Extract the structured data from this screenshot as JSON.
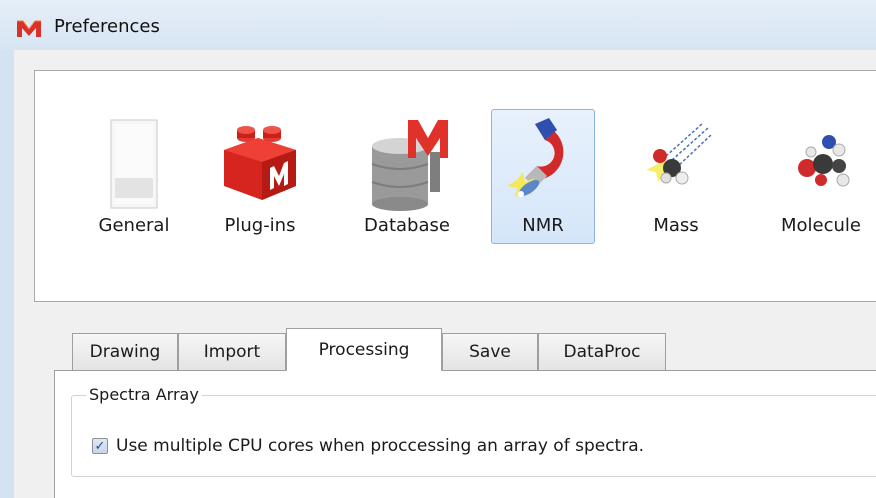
{
  "window": {
    "title": "Preferences",
    "icon": "mestrenova-m-icon"
  },
  "categories": [
    {
      "label": "General",
      "icon": "document-page-icon",
      "selected": false
    },
    {
      "label": "Plug-ins",
      "icon": "red-lego-brick-icon",
      "selected": false
    },
    {
      "label": "Database",
      "icon": "database-cylinder-icon",
      "selected": false
    },
    {
      "label": "NMR",
      "icon": "magnet-icon",
      "selected": true
    },
    {
      "label": "Mass",
      "icon": "molecule-beam-icon",
      "selected": false
    },
    {
      "label": "Molecule",
      "icon": "molecule-balls-icon",
      "selected": false
    }
  ],
  "tabs": [
    {
      "label": "Drawing",
      "active": false
    },
    {
      "label": "Import",
      "active": false
    },
    {
      "label": "Processing",
      "active": true
    },
    {
      "label": "Save",
      "active": false
    },
    {
      "label": "DataProc",
      "active": false
    }
  ],
  "processing": {
    "group_title": "Spectra Array",
    "checkbox": {
      "label": "Use multiple CPU cores when proccessing an array of spectra.",
      "checked": true,
      "check_glyph": "✓"
    }
  },
  "colors": {
    "selection_fill": "#d5e6fa",
    "selection_border": "#8fb3e0",
    "titlebar": "#d7e5f3"
  }
}
